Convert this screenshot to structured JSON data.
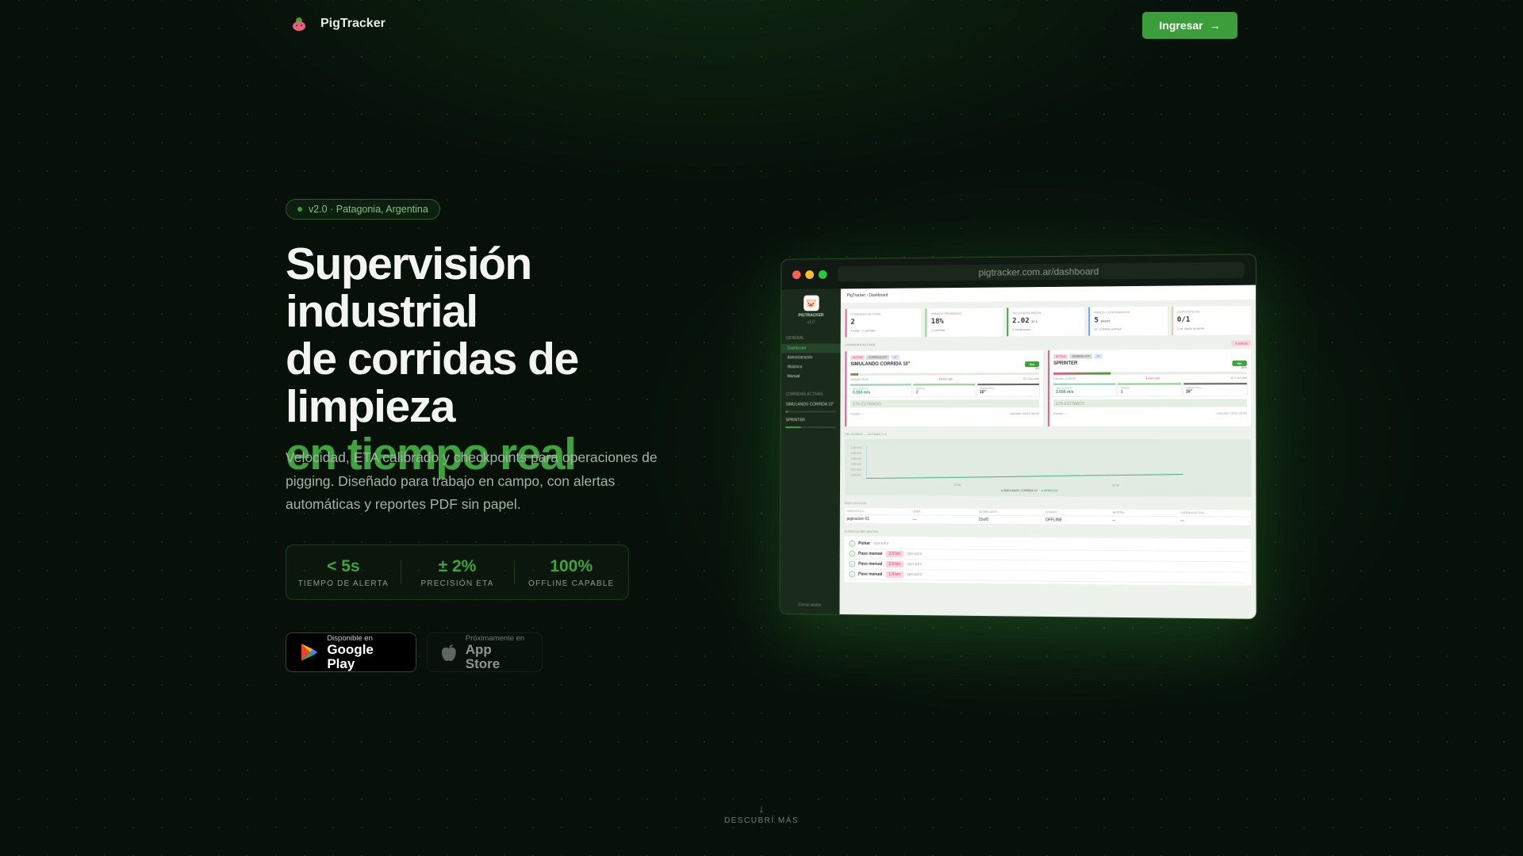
{
  "header": {
    "brand": "PigTracker",
    "login_label": "Ingresar",
    "login_icon": "arrow-right-icon"
  },
  "hero": {
    "badge": "v2.0 · Patagonia, Argentina",
    "title_lines": [
      "Supervisión industrial",
      "de corridas de",
      "limpieza"
    ],
    "title_highlight": "en tiempo real",
    "description": "Velocidad, ETA calibrado y checkpoints para operaciones de pigging. Diseñado para trabajo en campo, con alertas automáticas y reportes PDF sin papel.",
    "stats": [
      {
        "value": "< 5s",
        "label": "TIEMPO DE ALERTA"
      },
      {
        "value": "± 2%",
        "label": "PRECISIÓN ETA"
      },
      {
        "value": "100%",
        "label": "OFFLINE CAPABLE"
      }
    ],
    "stores": [
      {
        "small": "Disponible en",
        "big": "Google Play"
      },
      {
        "small": "Próximamente en",
        "big": "App Store"
      }
    ]
  },
  "scroll": {
    "label": "DESCUBRÍ MÁS",
    "icon": "arrow-down-icon"
  },
  "mockup": {
    "url": "pigtracker.com.ar/dashboard",
    "sidebar": {
      "brand": "PIGTRACKER",
      "version": "v1.0",
      "section": "GENERAL",
      "items": [
        "Dashboard",
        "Administración",
        "Histórico",
        "Manual"
      ],
      "runs_section": "CORRIDAS ACTIVAS",
      "runs": [
        {
          "name": "SIMULANDO CORRIDA 10\"",
          "pct": "4%"
        },
        {
          "name": "SPRINTER",
          "pct": "30%"
        }
      ],
      "footer": "Cerrar sesión"
    },
    "breadcrumb": "PigTracker › Dashboard",
    "cards": [
      {
        "label": "CORRIDAS ACTIVAS",
        "value": "2",
        "sub": "4 total · 2 corridas",
        "color": "#e3608a"
      },
      {
        "label": "AVANCE PROMEDIO",
        "value": "18%",
        "sub": "2 corridas",
        "color": "#8fd38f"
      },
      {
        "label": "VELOCIDAD MEDIA",
        "value": "2.02",
        "unit": "m/s",
        "sub": "2 mediciones",
        "color": "#3fa33d"
      },
      {
        "label": "PASOS CONFIRMADOS",
        "value": "5",
        "unit": "pasos",
        "sub": "En corridas activas",
        "color": "#6aa6f0"
      },
      {
        "label": "DISPOSITIVOS",
        "value": "0/1",
        "sub": "1 en canal reciente",
        "color": "#f3c6a8"
      }
    ],
    "active_label": "CORRIDAS ACTIVAS",
    "active_pill": "2 activas",
    "runs": [
      {
        "tags": [
          "ACTIVA",
          "CORRIDA OTF",
          "10\""
        ],
        "name": "SIMULANDO CORRIDA 10\"",
        "pct": "4%",
        "progress": 4,
        "left": "Lanzado 05:00",
        "mid": "4.6 km usd",
        "right": "52.3 km total",
        "speed": "0.163 m/s",
        "steps": "2",
        "diam": "10\"",
        "eta": "ETA ESTIMADO",
        "foot": "Equipo —",
        "foot_r": "Lanzado 10/10 08:00",
        "button": "Ver"
      },
      {
        "tags": [
          "ACTIVA",
          "GENERA OTF",
          "16\""
        ],
        "name": "SPRINTER",
        "pct": "30%",
        "progress": 30,
        "left": "Lanzado 11:55:00",
        "mid": "6.8 km usd",
        "right": "20.0 km total",
        "speed": "3.556 m/s",
        "steps": "1",
        "diam": "16\"",
        "eta": "ETA ESTIMADO",
        "foot": "Equipo —",
        "foot_r": "Lanzado 10/10 09:50",
        "button": "Ver"
      }
    ],
    "metric_labels": [
      "VELOCIDAD",
      "PASOS",
      "DIÁMETRO"
    ],
    "chart": {
      "title": "VELOCIDAD — ÚLTIMAS 2 H",
      "yticks": [
        "1.00 m/s",
        "0.80 m/s",
        "0.60 m/s",
        "0.40 m/s",
        "0.20 m/s",
        "0.00 m/s"
      ],
      "xticks": [
        "21 hs",
        "22 hs"
      ],
      "legend": [
        "SIMULANDO CORRIDA 10\"",
        "SPRINTER"
      ]
    },
    "devices": {
      "title": "DISPOSITIVOS",
      "headers": [
        "DISPOSITIVO",
        "LÍNEA",
        "ÚLTIMO DATO",
        "ESTADO",
        "BATERÍA",
        "CORRIDA ACTIVA"
      ],
      "row": [
        "pigtracker-01",
        "—",
        "15s/0",
        "OFFLINE",
        "–",
        "—"
      ]
    },
    "events": {
      "title": "EVENTOS RECIENTES",
      "items": [
        {
          "t": "Pulsar",
          "tag": "",
          "who": "operador"
        },
        {
          "t": "Paso manual",
          "tag": "2.0 km",
          "who": "operador"
        },
        {
          "t": "Paso manual",
          "tag": "2.0 km",
          "who": "operador"
        },
        {
          "t": "Paso manual",
          "tag": "1.9 km",
          "who": "operador"
        }
      ]
    }
  }
}
